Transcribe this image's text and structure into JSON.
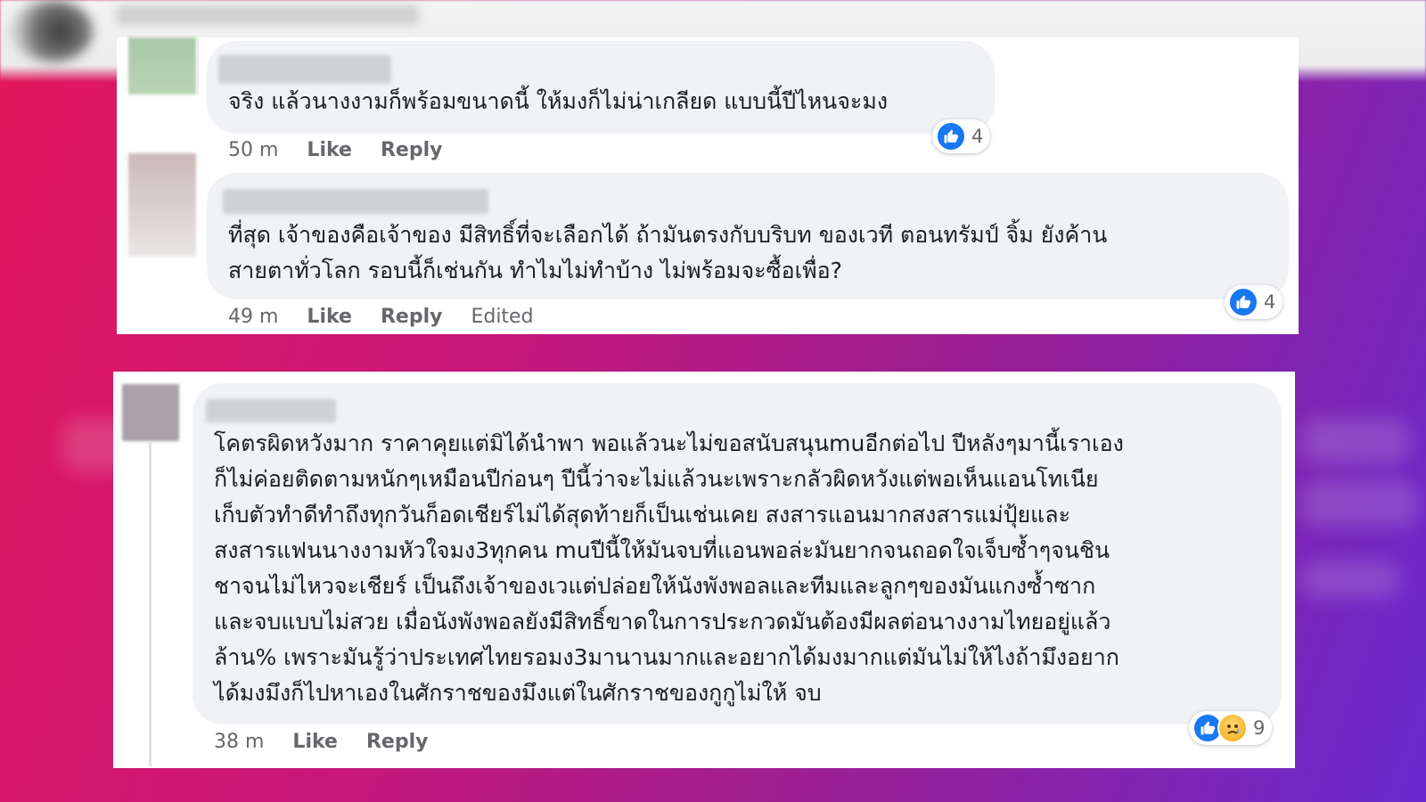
{
  "comments": [
    {
      "text": "จริง แล้วนางงามก็พร้อมขนาดนี้ ให้มงก็ไม่น่าเกลียด แบบนี้ปีไหนจะมง",
      "time": "50 m",
      "like_label": "Like",
      "reply_label": "Reply",
      "reaction_count": "4",
      "reactions": [
        "like-icon"
      ]
    },
    {
      "text": "ที่สุด เจ้าของคือเจ้าของ มีสิทธิ์ที่จะเลือกได้ ถ้ามันตรงกับบริบท ของเวที ตอนทรัมป์ จิ้ม ยังค้าน\nสายตาทั่วโลก รอบนี้ก็เช่นกัน ทำไมไม่ทำบ้าง ไม่พร้อมจะซื้อเพื่อ?",
      "time": "49 m",
      "like_label": "Like",
      "reply_label": "Reply",
      "edited_label": "Edited",
      "reaction_count": "4",
      "reactions": [
        "like-icon"
      ]
    },
    {
      "text": "โคตรผิดหวังมาก ราคาคุยแต่มิได้นำพา พอแล้วนะไม่ขอสนับสนุนmuอีกต่อไป ปีหลังๆมานี้เราเอง\nก็ไม่ค่อยติดตามหนักๆเหมือนปีก่อนๆ ปีนี้ว่าจะไม่แล้วนะเพราะกลัวผิดหวังแต่พอเห็นแอนโทเนีย\nเก็บตัวทำดีทำถึงทุกวันก็อดเชียร์ไม่ได้สุดท้ายก็เป็นเช่นเคย สงสารแอนมากสงสารแม่ปุ้ยและ\nสงสารแฟนนางงามหัวใจมง3ทุกคน muปีนี้ให้มันจบที่แอนพอล่ะมันยากจนถอดใจเจ็บซ้ำๆจนชิน\nชาจนไม่ไหวจะเชียร์ เป็นถึงเจ้าของเวแต่ปล่อยให้นังพังพอลและทีมและลูกๆของมันแกงซ้ำซาก\nและจบแบบไม่สวย เมื่อนังพังพอลยังมีสิทธิ์ขาดในการประกวดมันต้องมีผลต่อนางงามไทยอยู่แล้ว\nล้าน% เพราะมันรู้ว่าประเทศไทยรอมง3มานานมากและอยากได้มงมากแต่มันไม่ให้ไงถ้ามึงอยาก\nได้มงมึงก็ไปหาเองในศักราชของมึงแต่ในศักราชของกูกูไม่ให้ จบ",
      "time": "38 m",
      "like_label": "Like",
      "reply_label": "Reply",
      "reaction_count": "9",
      "reactions": [
        "like-icon",
        "sad-face-icon"
      ]
    }
  ],
  "colors": {
    "like_blue": "#1877f2",
    "bubble_bg": "#f0f2f5",
    "meta_gray": "#65676b",
    "text": "#1c1e21"
  }
}
